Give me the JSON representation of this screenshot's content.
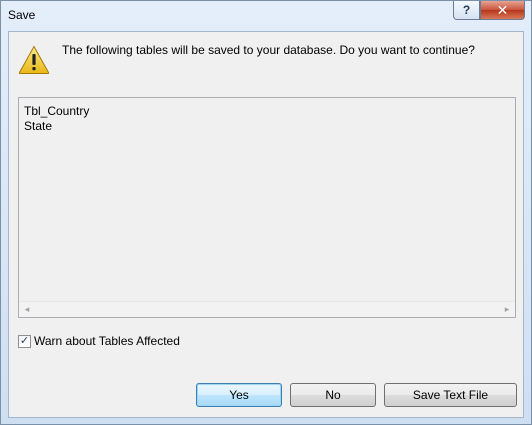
{
  "window": {
    "title": "Save",
    "help_label": "?",
    "close_label": "✕"
  },
  "dialog": {
    "message": "The following tables will be saved to your database. Do you want to continue?",
    "tables": [
      "Tbl_Country",
      "State"
    ],
    "scroll_left": "◂",
    "scroll_right": "▸",
    "warn_checkbox": {
      "label": "Warn about Tables Affected",
      "checked": true,
      "mark": "✓"
    },
    "buttons": {
      "yes": "Yes",
      "no": "No",
      "save_text": "Save Text File"
    }
  },
  "icons": {
    "warning": "warning-triangle-icon"
  },
  "colors": {
    "warning_fill": "#f5d54a",
    "default_button_border": "#3c7fb1"
  }
}
